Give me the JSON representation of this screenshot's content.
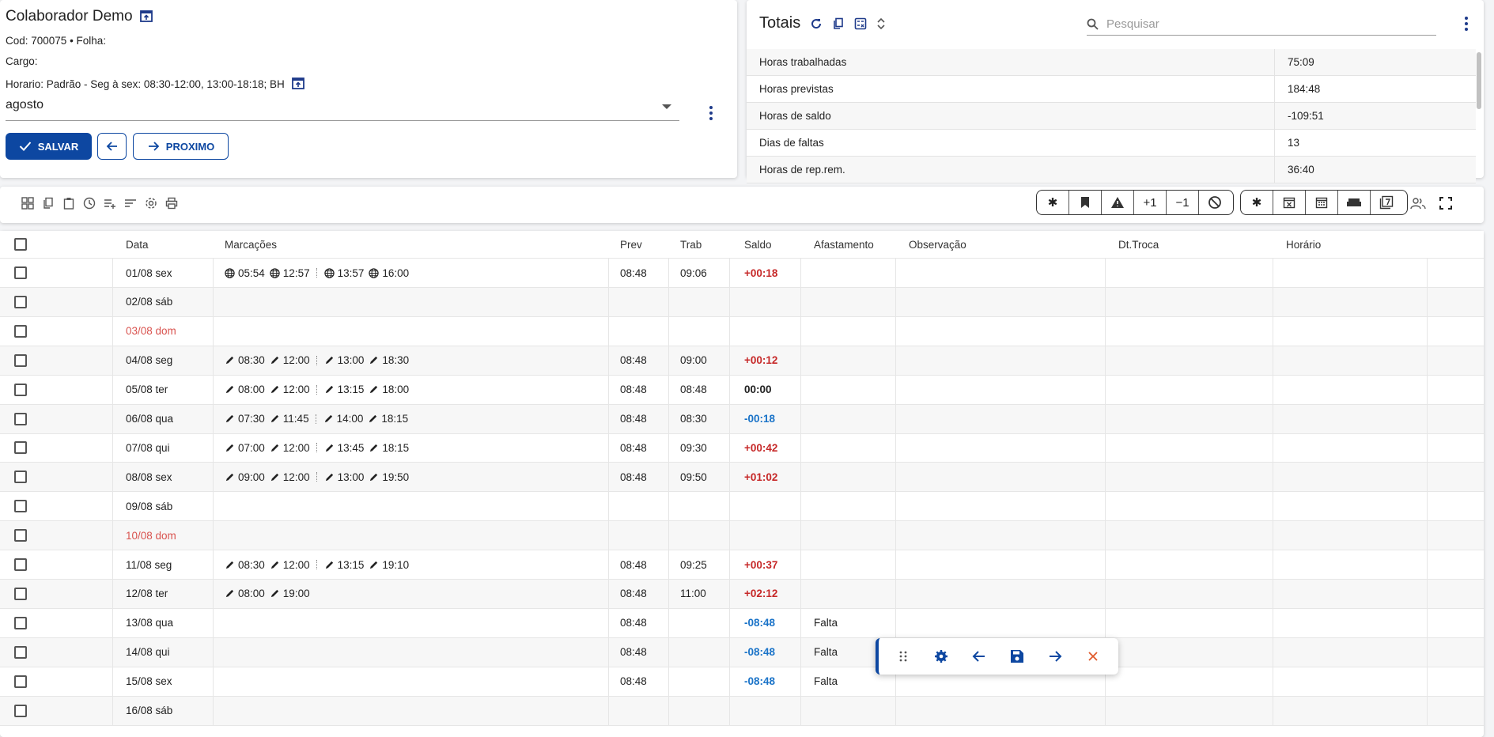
{
  "employee": {
    "name": "Colaborador Demo",
    "code_line": "Cod: 700075 • Folha:",
    "cargo": "Cargo:",
    "horario": "Horario: Padrão - Seg à sex: 08:30-12:00, 13:00-18:18; BH",
    "month": "agosto",
    "save_label": "SALVAR",
    "next_label": "PROXIMO"
  },
  "totals": {
    "title": "Totais",
    "search_placeholder": "Pesquisar",
    "rows": [
      {
        "label": "Horas trabalhadas",
        "value": "75:09"
      },
      {
        "label": "Horas previstas",
        "value": "184:48"
      },
      {
        "label": "Horas de saldo",
        "value": "-109:51"
      },
      {
        "label": "Dias de faltas",
        "value": "13"
      },
      {
        "label": "Horas de rep.rem.",
        "value": "36:40"
      }
    ]
  },
  "toolbar": {
    "left_icons": [
      "grid-icon",
      "copy-icon",
      "clipboard-icon",
      "clock-icon",
      "playlist-add-icon",
      "sort-icon",
      "settings-icon",
      "print-icon"
    ],
    "chips_a": [
      "✱",
      "bookmark-icon",
      "warning-icon",
      "+1",
      "−1",
      "block-icon"
    ],
    "chips_b": [
      "✱",
      "calendar-x-icon",
      "calendar-icon",
      "sofa-icon",
      "calendar-7-icon"
    ]
  },
  "grid": {
    "headers": [
      "Data",
      "Marcações",
      "Prev",
      "Trab",
      "Saldo",
      "Afastamento",
      "Observação",
      "Dt.Troca",
      "Horário"
    ],
    "rows": [
      {
        "date": "01/08 sex",
        "weekend": false,
        "type": "web",
        "punches": [
          "05:54",
          "12:57",
          "13:57",
          "16:00"
        ],
        "prev": "08:48",
        "trab": "09:06",
        "saldo": "+00:18",
        "sign": "pos",
        "afast": ""
      },
      {
        "date": "02/08 sáb",
        "weekend": false,
        "type": "",
        "punches": [],
        "prev": "",
        "trab": "",
        "saldo": "",
        "sign": "",
        "afast": ""
      },
      {
        "date": "03/08 dom",
        "weekend": true,
        "type": "",
        "punches": [],
        "prev": "",
        "trab": "",
        "saldo": "",
        "sign": "",
        "afast": ""
      },
      {
        "date": "04/08 seg",
        "weekend": false,
        "type": "edit",
        "punches": [
          "08:30",
          "12:00",
          "13:00",
          "18:30"
        ],
        "prev": "08:48",
        "trab": "09:00",
        "saldo": "+00:12",
        "sign": "pos",
        "afast": ""
      },
      {
        "date": "05/08 ter",
        "weekend": false,
        "type": "edit",
        "punches": [
          "08:00",
          "12:00",
          "13:15",
          "18:00"
        ],
        "prev": "08:48",
        "trab": "08:48",
        "saldo": "00:00",
        "sign": "zero",
        "afast": ""
      },
      {
        "date": "06/08 qua",
        "weekend": false,
        "type": "edit",
        "punches": [
          "07:30",
          "11:45",
          "14:00",
          "18:15"
        ],
        "prev": "08:48",
        "trab": "08:30",
        "saldo": "-00:18",
        "sign": "neg",
        "afast": ""
      },
      {
        "date": "07/08 qui",
        "weekend": false,
        "type": "edit",
        "punches": [
          "07:00",
          "12:00",
          "13:45",
          "18:15"
        ],
        "prev": "08:48",
        "trab": "09:30",
        "saldo": "+00:42",
        "sign": "pos",
        "afast": ""
      },
      {
        "date": "08/08 sex",
        "weekend": false,
        "type": "edit",
        "punches": [
          "09:00",
          "12:00",
          "13:00",
          "19:50"
        ],
        "prev": "08:48",
        "trab": "09:50",
        "saldo": "+01:02",
        "sign": "pos",
        "afast": ""
      },
      {
        "date": "09/08 sáb",
        "weekend": false,
        "type": "",
        "punches": [],
        "prev": "",
        "trab": "",
        "saldo": "",
        "sign": "",
        "afast": ""
      },
      {
        "date": "10/08 dom",
        "weekend": true,
        "type": "",
        "punches": [],
        "prev": "",
        "trab": "",
        "saldo": "",
        "sign": "",
        "afast": ""
      },
      {
        "date": "11/08 seg",
        "weekend": false,
        "type": "edit",
        "punches": [
          "08:30",
          "12:00",
          "13:15",
          "19:10"
        ],
        "prev": "08:48",
        "trab": "09:25",
        "saldo": "+00:37",
        "sign": "pos",
        "afast": ""
      },
      {
        "date": "12/08 ter",
        "weekend": false,
        "type": "edit",
        "punches": [
          "08:00",
          "19:00"
        ],
        "prev": "08:48",
        "trab": "11:00",
        "saldo": "+02:12",
        "sign": "pos",
        "afast": ""
      },
      {
        "date": "13/08 qua",
        "weekend": false,
        "type": "",
        "punches": [],
        "prev": "08:48",
        "trab": "",
        "saldo": "-08:48",
        "sign": "neg",
        "afast": "Falta"
      },
      {
        "date": "14/08 qui",
        "weekend": false,
        "type": "",
        "punches": [],
        "prev": "08:48",
        "trab": "",
        "saldo": "-08:48",
        "sign": "neg",
        "afast": "Falta"
      },
      {
        "date": "15/08 sex",
        "weekend": false,
        "type": "",
        "punches": [],
        "prev": "08:48",
        "trab": "",
        "saldo": "-08:48",
        "sign": "neg",
        "afast": "Falta"
      },
      {
        "date": "16/08 sáb",
        "weekend": false,
        "type": "",
        "punches": [],
        "prev": "",
        "trab": "",
        "saldo": "",
        "sign": "",
        "afast": ""
      }
    ]
  },
  "floatbar": {
    "icons": [
      "drag-handle-icon",
      "settings-icon",
      "arrow-left-icon",
      "save-icon",
      "arrow-right-icon",
      "close-icon"
    ]
  }
}
